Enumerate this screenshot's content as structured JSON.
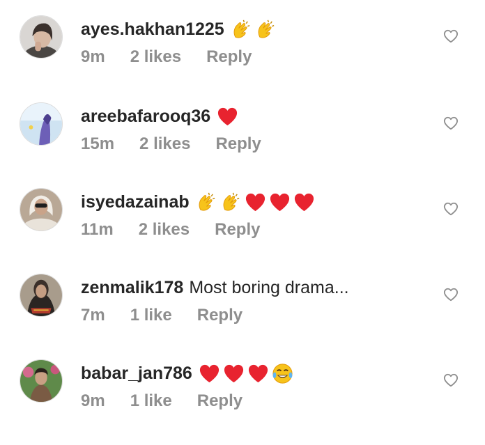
{
  "comments": [
    {
      "username": "ayes.hakhan1225",
      "text": "",
      "emojis": [
        "clap-emoji",
        "clap-emoji"
      ],
      "time": "9m",
      "likes": "2 likes",
      "reply": "Reply"
    },
    {
      "username": "areebafarooq36",
      "text": "",
      "emojis": [
        "red-heart-emoji"
      ],
      "time": "15m",
      "likes": "2 likes",
      "reply": "Reply"
    },
    {
      "username": "isyedazainab",
      "text": "",
      "emojis": [
        "clap-emoji",
        "clap-emoji",
        "red-heart-emoji",
        "red-heart-emoji",
        "red-heart-emoji"
      ],
      "time": "11m",
      "likes": "2 likes",
      "reply": "Reply"
    },
    {
      "username": "zenmalik178",
      "text": "Most boring drama...",
      "emojis": [],
      "time": "7m",
      "likes": "1 like",
      "reply": "Reply"
    },
    {
      "username": "babar_jan786",
      "text": "",
      "emojis": [
        "red-heart-emoji",
        "red-heart-emoji",
        "red-heart-emoji",
        "tears-of-joy-emoji"
      ],
      "time": "9m",
      "likes": "1 like",
      "reply": "Reply"
    }
  ],
  "icons": {
    "like": "heart-outline-icon"
  },
  "colors": {
    "username": "#262626",
    "meta": "#8e8e8e",
    "heart_outline": "#8e8e8e",
    "emoji_heart": "#e8232f",
    "emoji_clap": "#f7c31b"
  }
}
